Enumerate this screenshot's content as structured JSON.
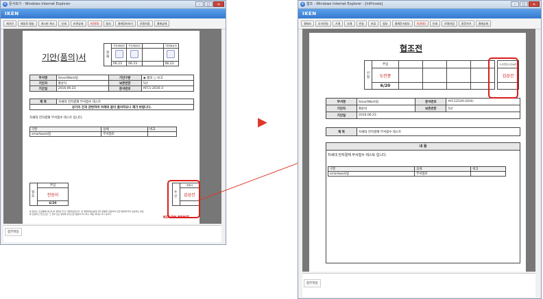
{
  "left": {
    "window_title": "문서보기 - Windows Internet Explorer",
    "brand": "IKEN",
    "toolbar": [
      "재기안",
      "매일로 발송",
      "게시판 게시",
      "인쇄",
      "보관상세",
      "의견(0)",
      "첨부",
      "결재정보보기",
      "로컬저장",
      "결재상태"
    ],
    "doc": {
      "title": "기안(품의)서",
      "approval_label": "결재",
      "approvers": [
        {
          "role": "기안/팀승인",
          "date": "06.23"
        },
        {
          "role": "기안/팀승인",
          "date": "06.23"
        },
        {
          "role": "",
          "date": ""
        },
        {
          "role": "기안/팀승인",
          "date": "06.23"
        }
      ],
      "rows": [
        {
          "k1": "부서명",
          "v1": "SmartWork팀",
          "k2": "기안구분",
          "v2": "◉ 품의  ○ 보고"
        },
        {
          "k1": "기안자",
          "v1": "황윤덕",
          "k2": "보존연한",
          "v2": "5년"
        },
        {
          "k1": "기안일",
          "v1": "2016.06.23",
          "k2": "문서번호",
          "v2": "AFC1-2016-3"
        }
      ],
      "subject_label": "제 목",
      "subject": "차세대 전자결재 부서접수 테스트",
      "request": "상기의 건과 관련하여 아래와 같이 품의하오니 재가 바랍니다.",
      "body": "차세대 전자결재 부서접수 테스트 입니다.",
      "grid_headers": [
        "구분",
        "상세",
        "비고"
      ],
      "grid_row": [
        "smartwork팀",
        "부서협조",
        ""
      ],
      "coop_label": "협조",
      "coop_role": "주임",
      "coop_name": "전승이",
      "coop_date": "6/20",
      "recv_label": "수신",
      "recv_role": "과계사",
      "recv_name": "김상건",
      "footnote": "본 문서는 코오롱베니트(주)의 영업상 주요 기밀자료입니다. 및 영업비밀보호에 관한 법률을 포함하여 관련 법령에 따라 보호되는 정보를 포함하고 있으므로, 그 전부 또는 일부를 무단으로 열람하거나 복사, 배포 해서는 아니 됩니다.",
      "company": "KOLON BENIT"
    },
    "attach_label": "첨부파일"
  },
  "arrow": "▶",
  "right": {
    "window_title": "협조 - Windows Internet Explorer - [InPrivate]",
    "brand": "IKEN",
    "toolbar": [
      "결재요",
      "부서전달",
      "기결",
      "부결",
      "반송",
      "보류",
      "첨부",
      "결재문서첨부",
      "의견(0)",
      "인쇄",
      "로컬저장",
      "원문보기",
      "결재상태"
    ],
    "doc": {
      "title": "협조전",
      "approval_label": "신청",
      "role": "주임",
      "name": "도민종",
      "date": "6/20",
      "recv_role": "수신/협조/수신/승인",
      "recv_name": "김상건",
      "rows": [
        {
          "k1": "부서명",
          "v1": "SmartWork팀",
          "k2": "문서번호",
          "v2": "AFC1Z100-2016-"
        },
        {
          "k1": "기안자",
          "v1": "황윤덕",
          "k2": "보존연한",
          "v2": "5년"
        },
        {
          "k1": "기안일",
          "v1": "2016.06.23",
          "k2": "",
          "v2": ""
        }
      ],
      "subject_label": "제 목",
      "subject": "차세대 전자결재 부서접수 테스트",
      "content_label": "내 용",
      "body": "차세대 전자결재 부서접수 테스트 입니다.",
      "grid_headers": [
        "구분",
        "상세",
        "비고"
      ],
      "grid_row": [
        "smartwork팀",
        "부서협조",
        ""
      ]
    },
    "attach_label": "첨부파일"
  },
  "colors": {
    "accent": "#3579cf",
    "highlight": "#d91c1c",
    "signature": "#c81818"
  }
}
